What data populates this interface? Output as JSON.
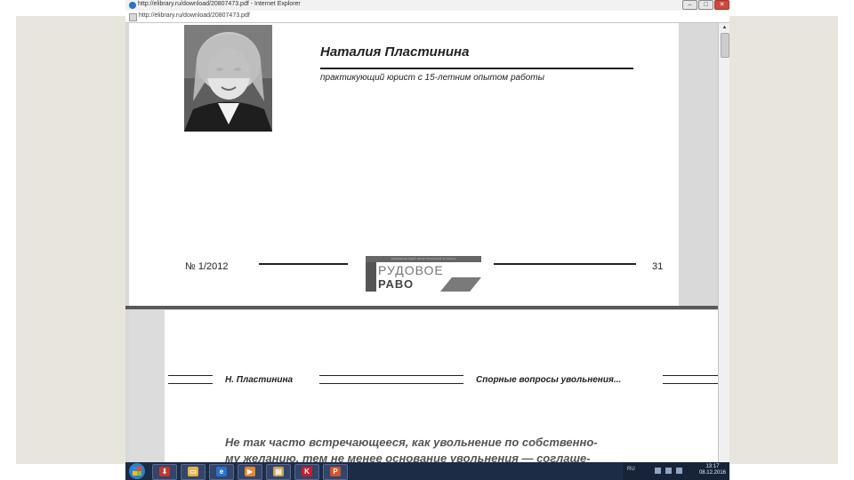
{
  "window": {
    "title": "http://elibrary.ru/download/20807473.pdf - Internet Explorer",
    "url": "http://elibrary.ru/download/20807473.pdf",
    "controls": {
      "minimize": "–",
      "maximize": "□",
      "close": "✕"
    }
  },
  "page1": {
    "author_name": "Наталия Пластинина",
    "author_description": "практикующий юрист с 15-летним опытом работы",
    "issue": "№ 1/2012",
    "page_number": "31",
    "logo": {
      "top_bar": "ЕЖЕМЕСЯЧНЫЙ ПРАКТИЧЕСКИЙ ЖУРНАЛ",
      "word1": "РУДОВОЕ",
      "word2": "РАВО"
    }
  },
  "page2": {
    "running_author": "Н. Пластинина",
    "running_title": "Спорные вопросы увольнения...",
    "body_line1": "Не так часто встречающееся, как увольнение по собственно-",
    "body_line2": "му желанию, тем не менее основание увольнения — соглаше-"
  },
  "taskbar": {
    "apps": [
      {
        "name": "download-manager",
        "glyph": "⬇",
        "color": "#c8332b"
      },
      {
        "name": "file-explorer",
        "glyph": "▭",
        "color": "#e3b44a"
      },
      {
        "name": "internet-explorer",
        "glyph": "e",
        "color": "#2a73c9"
      },
      {
        "name": "media-player",
        "glyph": "▶",
        "color": "#e8862a"
      },
      {
        "name": "folder",
        "glyph": "▤",
        "color": "#c9a35a"
      },
      {
        "name": "kaspersky",
        "glyph": "K",
        "color": "#c81e2e"
      },
      {
        "name": "powerpoint",
        "glyph": "P",
        "color": "#d2542b"
      }
    ],
    "language": "RU",
    "time": "13:17",
    "date": "08.12.2016"
  }
}
